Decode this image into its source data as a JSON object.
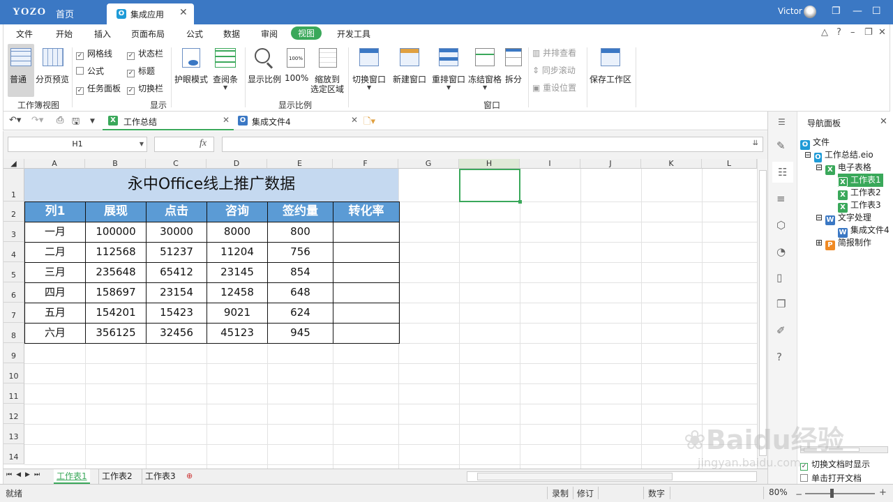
{
  "titlebar": {
    "logo": "YOZO",
    "home": "首页",
    "tab": "集成应用",
    "user": "Victor"
  },
  "menu": [
    "文件",
    "开始",
    "插入",
    "页面布局",
    "公式",
    "数据",
    "审阅",
    "视图",
    "开发工具"
  ],
  "ribbon": {
    "normal": "普通",
    "page_preview": "分页预览",
    "group_workbook_view": "工作簿视图",
    "checks": [
      {
        "label": "网格线",
        "checked": true
      },
      {
        "label": "公式",
        "checked": false
      },
      {
        "label": "任务面板",
        "checked": true
      },
      {
        "label": "状态栏",
        "checked": true
      },
      {
        "label": "标题",
        "checked": true
      },
      {
        "label": "切换栏",
        "checked": true
      }
    ],
    "group_display": "显示",
    "eye_mode": "护眼模式",
    "view_bar": "查阅条",
    "zoom": "显示比例",
    "zoom100": "100%",
    "zoom_sel_1": "缩放到",
    "zoom_sel_2": "选定区域",
    "group_zoom": "显示比例",
    "switch_win": "切换窗口",
    "new_win": "新建窗口",
    "arrange": "重排窗口",
    "freeze": "冻结窗格",
    "split": "拆分",
    "side_by_side": "并排查看",
    "sync_scroll": "同步滚动",
    "reset_pos": "重设位置",
    "group_window": "窗口",
    "save_workspace": "保存工作区"
  },
  "doctabs": {
    "tab1": "工作总结",
    "tab2": "集成文件4"
  },
  "formula": {
    "namebox": "H1",
    "fx": "fx",
    "value": ""
  },
  "columns": [
    "A",
    "B",
    "C",
    "D",
    "E",
    "F",
    "G",
    "H",
    "I",
    "J",
    "K",
    "L"
  ],
  "rows": [
    "1",
    "2",
    "3",
    "4",
    "5",
    "6",
    "7",
    "8",
    "9",
    "10",
    "11",
    "12",
    "13",
    "14"
  ],
  "table": {
    "title": "永中Office线上推广数据",
    "headers": [
      "列1",
      "展现",
      "点击",
      "咨询",
      "签约量",
      "转化率"
    ],
    "data": [
      [
        "一月",
        "100000",
        "30000",
        "8000",
        "800",
        ""
      ],
      [
        "二月",
        "112568",
        "51237",
        "11204",
        "756",
        ""
      ],
      [
        "三月",
        "235648",
        "65412",
        "23145",
        "854",
        ""
      ],
      [
        "四月",
        "158697",
        "23154",
        "12458",
        "648",
        ""
      ],
      [
        "五月",
        "154201",
        "15423",
        "9021",
        "624",
        ""
      ],
      [
        "六月",
        "356125",
        "32456",
        "45123",
        "945",
        ""
      ]
    ]
  },
  "nav": {
    "title": "导航面板",
    "tree": {
      "root": "文件",
      "file": "工作总结.eio",
      "sheets_group": "电子表格",
      "sheets": [
        "工作表1",
        "工作表2",
        "工作表3"
      ],
      "word_group": "文字处理",
      "word_file": "集成文件4",
      "ppt_group": "简报制作"
    },
    "opt1": "切换文档时显示",
    "opt2": "单击打开文档"
  },
  "sheets": [
    "工作表1",
    "工作表2",
    "工作表3"
  ],
  "status": {
    "ready": "就绪",
    "record": "录制",
    "revise": "修订",
    "numlock": "数字",
    "zoom": "80%"
  },
  "watermark": "Baidu经验 jingyan.baidu.com"
}
